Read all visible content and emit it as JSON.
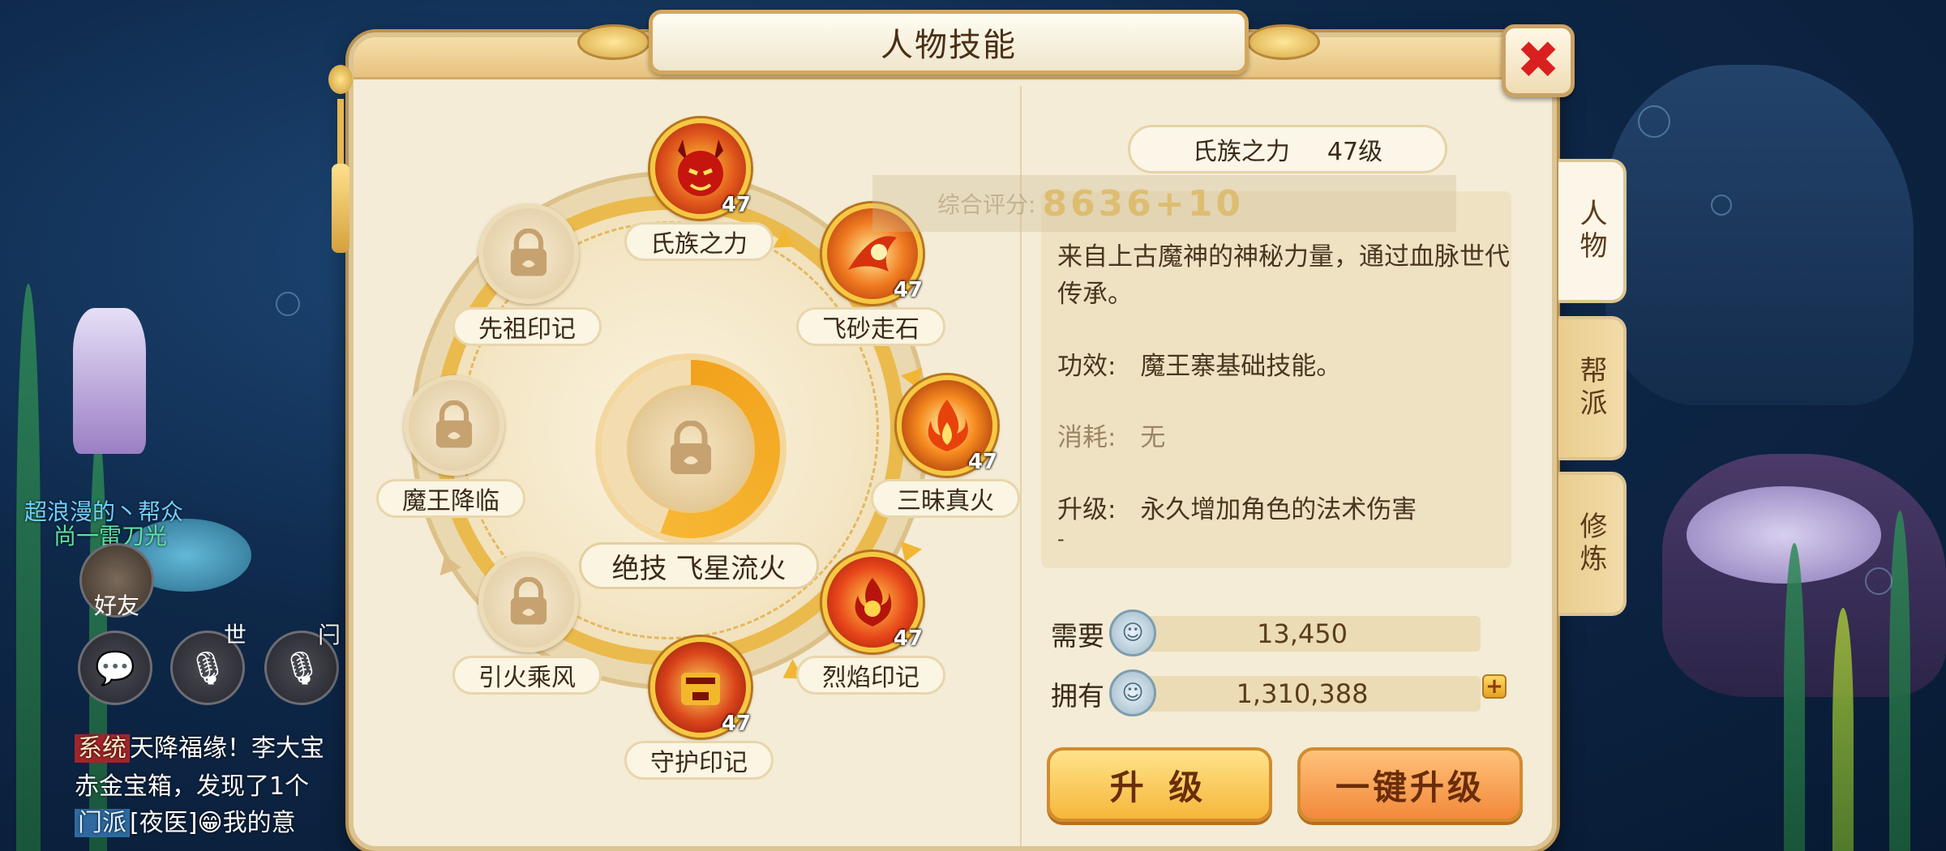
{
  "window": {
    "title": "人物技能"
  },
  "hud": {
    "player_name": "超浪漫的丶帮众",
    "player_title": "尚一雷刀光",
    "friends_label": "好友",
    "channel_world": "世",
    "channel_other": "闩",
    "chat": [
      {
        "tag": "系统",
        "text": "天降福缘！李大宝"
      },
      {
        "tag": "",
        "text": "赤金宝箱，发现了1个"
      },
      {
        "tag": "门派",
        "text": "[夜医]😁我的意"
      }
    ]
  },
  "wheel": {
    "ultimate_label": "绝技  飞星流火",
    "skills": [
      {
        "name": "氏族之力",
        "level": "47",
        "locked": false,
        "icon": "demon-face-icon",
        "color": "#d6281c"
      },
      {
        "name": "飞砂走石",
        "level": "47",
        "locked": false,
        "icon": "flying-rock-icon",
        "color": "#e0581a"
      },
      {
        "name": "三昧真火",
        "level": "47",
        "locked": false,
        "icon": "true-fire-icon",
        "color": "#f0701a"
      },
      {
        "name": "烈焰印记",
        "level": "47",
        "locked": false,
        "icon": "flame-mark-icon",
        "color": "#e03a12"
      },
      {
        "name": "守护印记",
        "level": "47",
        "locked": false,
        "icon": "guard-mark-icon",
        "color": "#c8301a"
      },
      {
        "name": "引火乘风",
        "level": "",
        "locked": true,
        "icon": "lock-icon",
        "color": "#c6a874"
      },
      {
        "name": "魔王降临",
        "level": "",
        "locked": true,
        "icon": "lock-icon",
        "color": "#c6a874"
      },
      {
        "name": "先祖印记",
        "level": "",
        "locked": true,
        "icon": "lock-icon",
        "color": "#c6a874"
      }
    ]
  },
  "detail": {
    "skill_name": "氏族之力",
    "skill_level": "47级",
    "score_label": "综合评分:",
    "score_value": "8636+10",
    "description": "来自上古魔神的神秘力量，通过血脉世代传承。",
    "effect_label": "功效:",
    "effect_value": "魔王寨基础技能。",
    "cost_label": "消耗:",
    "cost_value": "无",
    "upgrade_label": "升级:",
    "upgrade_value": "永久增加角色的法术伤害",
    "upgrade_more": "-"
  },
  "currency": {
    "need_label": "需要",
    "need_value": "13,450",
    "have_label": "拥有",
    "have_value": "1,310,388",
    "add_button": "+"
  },
  "buttons": {
    "upgrade": "升 级",
    "upgrade_all": "一键升级"
  },
  "tabs": [
    {
      "label": "人物",
      "active": true
    },
    {
      "label": "帮派",
      "active": false
    },
    {
      "label": "修炼",
      "active": false
    }
  ]
}
